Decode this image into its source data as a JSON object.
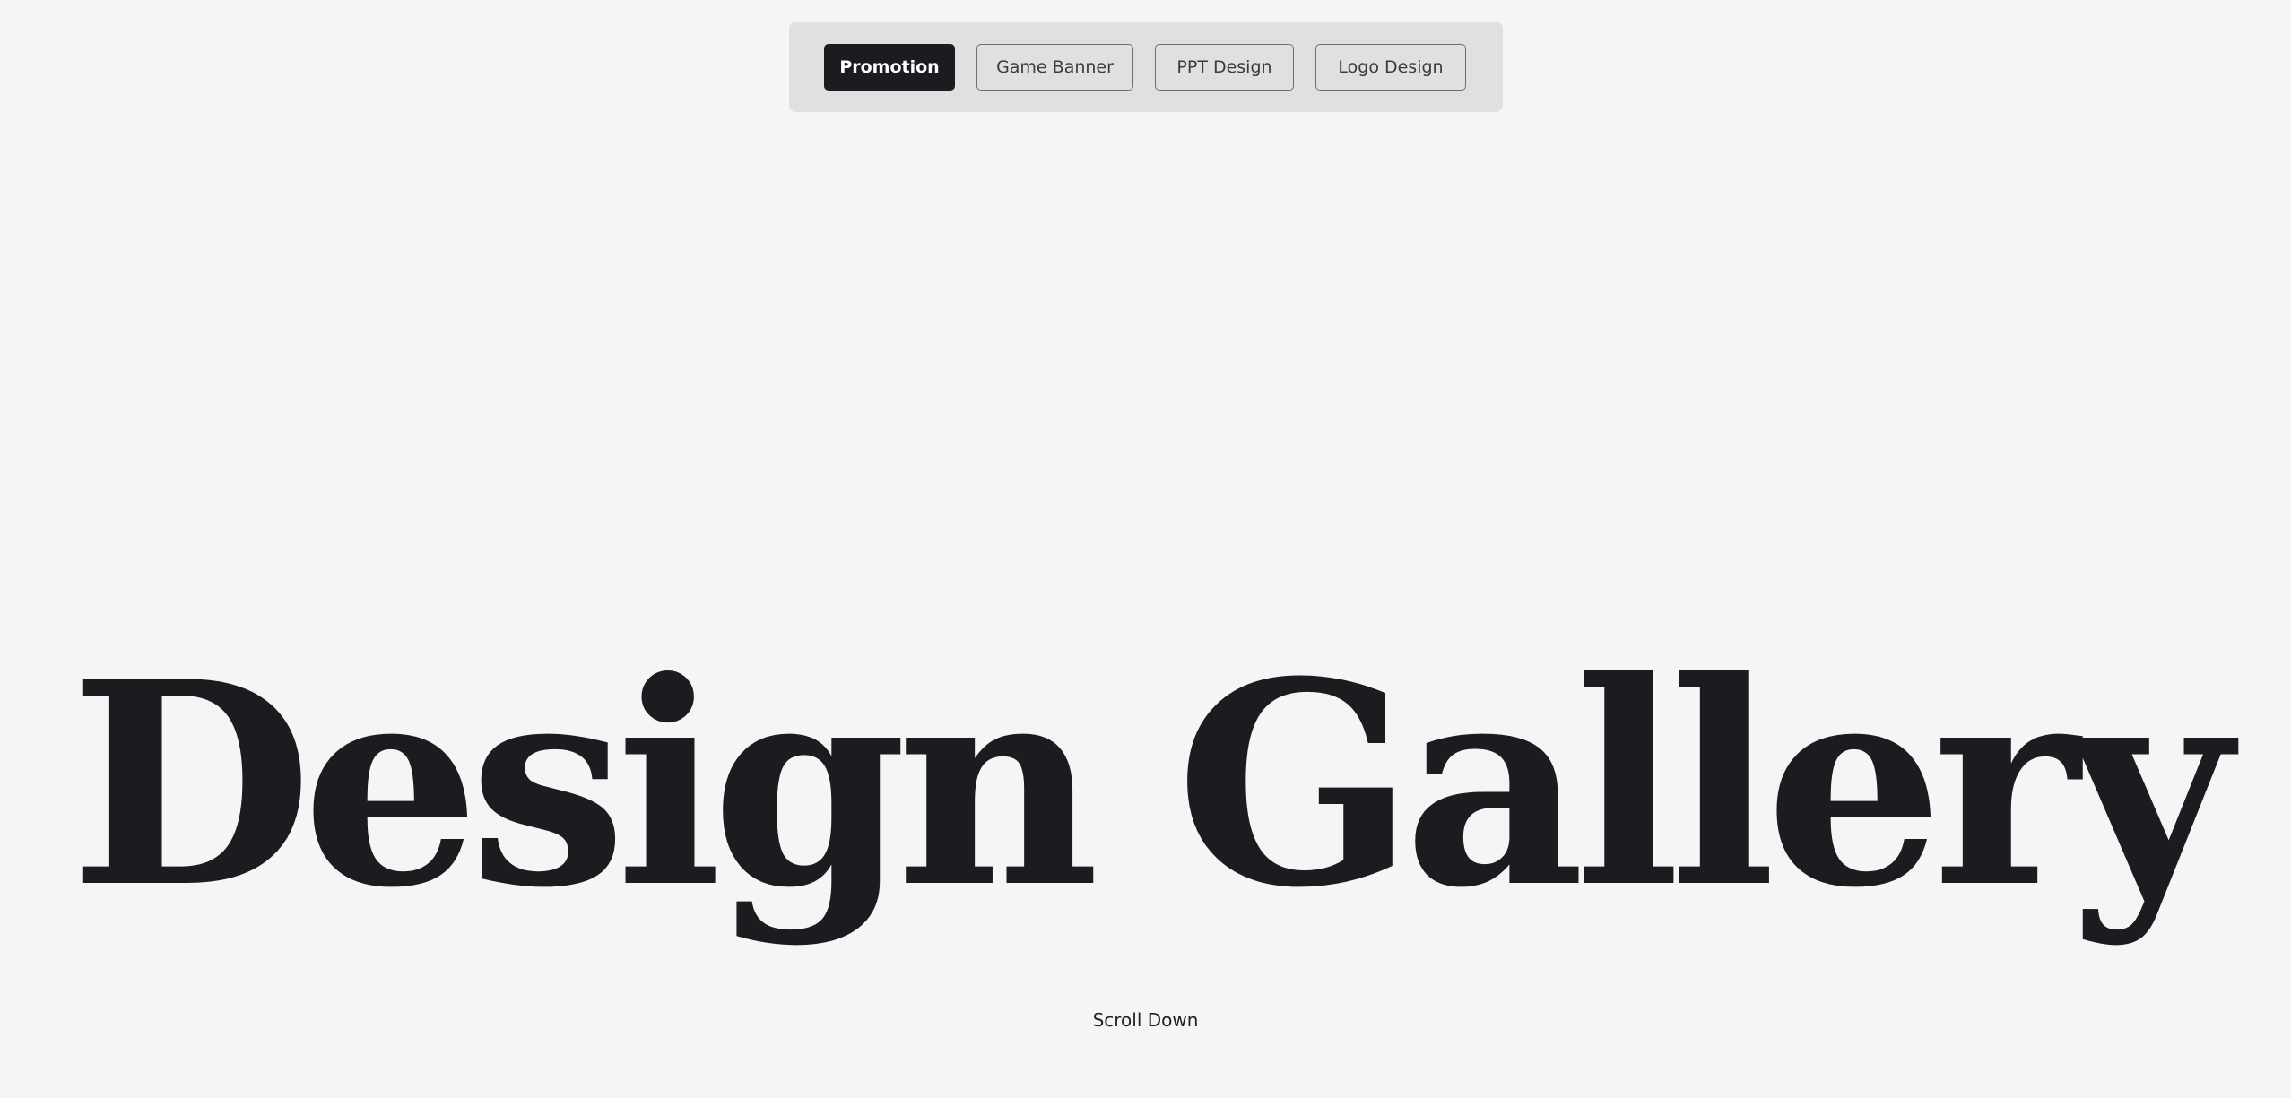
{
  "tabs": {
    "items": [
      {
        "label": "Promotion",
        "active": true
      },
      {
        "label": "Game Banner",
        "active": false
      },
      {
        "label": "PPT Design",
        "active": false
      },
      {
        "label": "Logo Design",
        "active": false
      }
    ]
  },
  "hero": {
    "title": "Design Gallery"
  },
  "scroll_hint": {
    "label": "Scroll Down"
  },
  "colors": {
    "background": "#f5f5f5",
    "tab_bar_background": "#e0e0e0",
    "active_tab": "#1a1c1f",
    "text": "#1a1c1f"
  }
}
